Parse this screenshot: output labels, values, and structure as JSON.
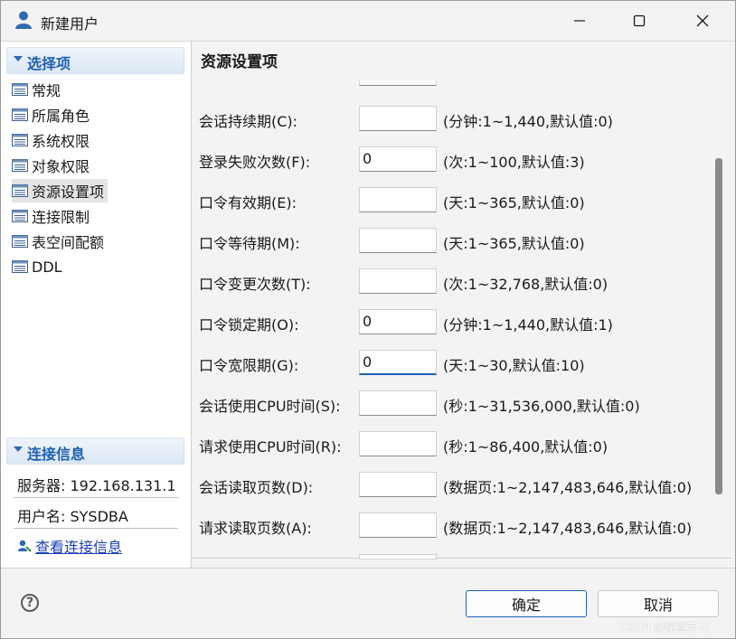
{
  "window": {
    "title": "新建用户"
  },
  "colors": {
    "accent": "#1f5fae",
    "link": "#1a3fb5",
    "selected_bg": "#e4e4e4",
    "scrollbar": "#8a8a8a"
  },
  "sidebar": {
    "options_header": "选择项",
    "items": [
      {
        "label": "常规",
        "icon": "list-icon",
        "selected": false
      },
      {
        "label": "所属角色",
        "icon": "list-icon",
        "selected": false
      },
      {
        "label": "系统权限",
        "icon": "list-icon",
        "selected": false
      },
      {
        "label": "对象权限",
        "icon": "list-icon",
        "selected": false
      },
      {
        "label": "资源设置项",
        "icon": "list-icon",
        "selected": true
      },
      {
        "label": "连接限制",
        "icon": "list-icon",
        "selected": false
      },
      {
        "label": "表空间配额",
        "icon": "list-icon",
        "selected": false
      },
      {
        "label": "DDL",
        "icon": "list-icon",
        "selected": false
      }
    ],
    "connection_header": "连接信息",
    "server": "服务器: 192.168.131.1",
    "username": "用户名: SYSDBA",
    "view_link": "查看连接信息"
  },
  "main": {
    "title": "资源设置项",
    "rows": [
      {
        "label": "会话持续期(C):",
        "value": "",
        "hint": "(分钟:1~1,440,默认值:0)"
      },
      {
        "label": "登录失败次数(F):",
        "value": "0",
        "hint": "(次:1~100,默认值:3)"
      },
      {
        "label": "口令有效期(E):",
        "value": "",
        "hint": "(天:1~365,默认值:0)"
      },
      {
        "label": "口令等待期(M):",
        "value": "",
        "hint": "(天:1~365,默认值:0)"
      },
      {
        "label": "口令变更次数(T):",
        "value": "",
        "hint": "(次:1~32,768,默认值:0)"
      },
      {
        "label": "口令锁定期(O):",
        "value": "0",
        "hint": "(分钟:1~1,440,默认值:1)"
      },
      {
        "label": "口令宽限期(G):",
        "value": "0",
        "hint": "(天:1~30,默认值:10)",
        "focused": true
      },
      {
        "label": "会话使用CPU时间(S):",
        "value": "",
        "hint": "(秒:1~31,536,000,默认值:0)"
      },
      {
        "label": "请求使用CPU时间(R):",
        "value": "",
        "hint": "(秒:1~86,400,默认值:0)"
      },
      {
        "label": "会话读取页数(D):",
        "value": "",
        "hint": "(数据页:1~2,147,483,646,默认值:0)"
      },
      {
        "label": "请求读取页数(A):",
        "value": "",
        "hint": "(数据页:1~2,147,483,646,默认值:0)"
      }
    ]
  },
  "footer": {
    "help_icon": "?",
    "ok": "确定",
    "cancel": "取消",
    "watermark": "CSDN @徐宣芳-Q"
  }
}
